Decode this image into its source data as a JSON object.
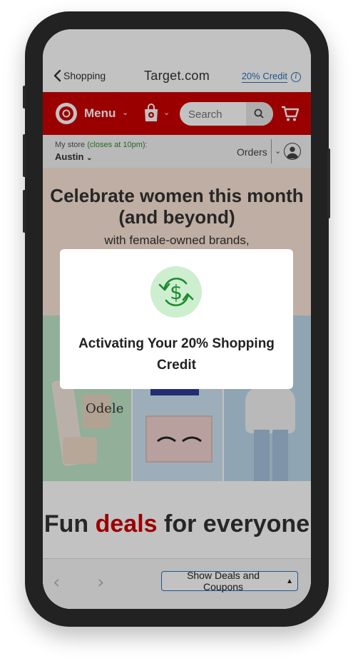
{
  "browser": {
    "back_label": "Shopping",
    "site_title": "Target.com",
    "credit_label": "20% Credit",
    "info_icon": "i"
  },
  "header": {
    "menu_label": "Menu",
    "search_placeholder": "Search",
    "brand_color": "#cc0000"
  },
  "store": {
    "my_store_label": "My store",
    "closes_text": "(closes at 10pm):",
    "store_name": "Austin",
    "orders_label": "Orders"
  },
  "content": {
    "promo_heading": "Celebrate women this month (and beyond)",
    "promo_sub": "with female-owned brands,",
    "tile_brand": "Odele",
    "deals_heading_1": "Fun",
    "deals_heading_red": "deals",
    "deals_heading_2": "for everyone"
  },
  "toolbar": {
    "deals_button": "Show Deals and Coupons"
  },
  "modal": {
    "title": "Activating Your 20% Shopping Credit",
    "icon": "dollar-refresh-icon",
    "icon_color": "#1e8a2e"
  }
}
